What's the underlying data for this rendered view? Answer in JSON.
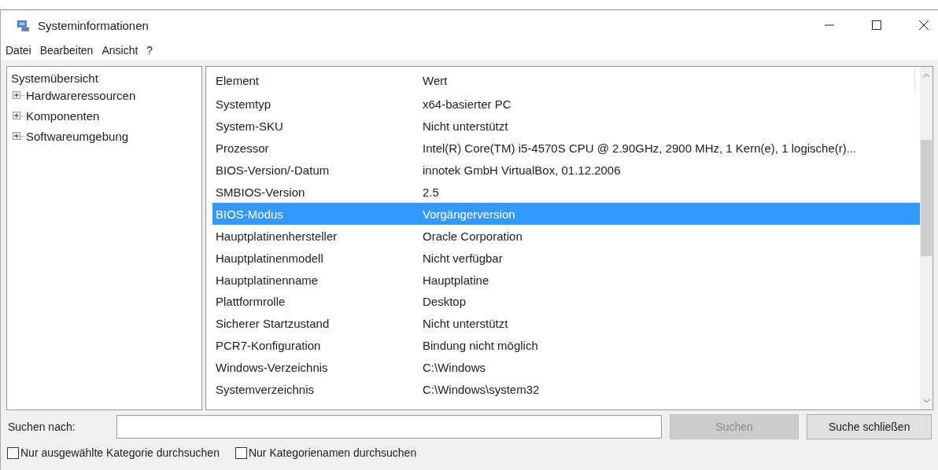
{
  "window": {
    "title": "Systeminformationen"
  },
  "menu": [
    "Datei",
    "Bearbeiten",
    "Ansicht",
    "?"
  ],
  "tree": {
    "label": "Systemübersicht",
    "selected": false,
    "children": [
      {
        "label": "Hardwareressourcen",
        "expanded": false
      },
      {
        "label": "Komponenten",
        "expanded": false
      },
      {
        "label": "Softwareumgebung",
        "expanded": false
      }
    ]
  },
  "table": {
    "columns": [
      "Element",
      "Wert"
    ],
    "rows": [
      {
        "element": "Systemtyp",
        "value": "x64-basierter PC",
        "selected": false
      },
      {
        "element": "System-SKU",
        "value": "Nicht unterstützt",
        "selected": false
      },
      {
        "element": "Prozessor",
        "value": "Intel(R) Core(TM) i5-4570S CPU @ 2.90GHz, 2900 MHz, 1 Kern(e), 1 logische(r)...",
        "selected": false
      },
      {
        "element": "BIOS-Version/-Datum",
        "value": "innotek GmbH VirtualBox, 01.12.2006",
        "selected": false
      },
      {
        "element": "SMBIOS-Version",
        "value": "2.5",
        "selected": false
      },
      {
        "element": "BIOS-Modus",
        "value": "Vorgängerversion",
        "selected": true
      },
      {
        "element": "Hauptplatinenhersteller",
        "value": "Oracle Corporation",
        "selected": false
      },
      {
        "element": "Hauptplatinenmodell",
        "value": "Nicht verfügbar",
        "selected": false
      },
      {
        "element": "Hauptplatinenname",
        "value": "Hauptplatine",
        "selected": false
      },
      {
        "element": "Plattformrolle",
        "value": "Desktop",
        "selected": false
      },
      {
        "element": "Sicherer Startzustand",
        "value": "Nicht unterstützt",
        "selected": false
      },
      {
        "element": "PCR7-Konfiguration",
        "value": "Bindung nicht möglich",
        "selected": false
      },
      {
        "element": "Windows-Verzeichnis",
        "value": "C:\\Windows",
        "selected": false
      },
      {
        "element": "Systemverzeichnis",
        "value": "C:\\Windows\\system32",
        "selected": false
      }
    ]
  },
  "search": {
    "label": "Suchen nach:",
    "search_button": {
      "label": "Suchen",
      "disabled": true
    },
    "close_button": {
      "label": "Suche schließen",
      "disabled": false
    }
  },
  "options": [
    {
      "label": "Nur ausgewählte Kategorie durchsuchen",
      "checked": false
    },
    {
      "label": "Nur Kategorienamen durchsuchen",
      "checked": false
    }
  ]
}
